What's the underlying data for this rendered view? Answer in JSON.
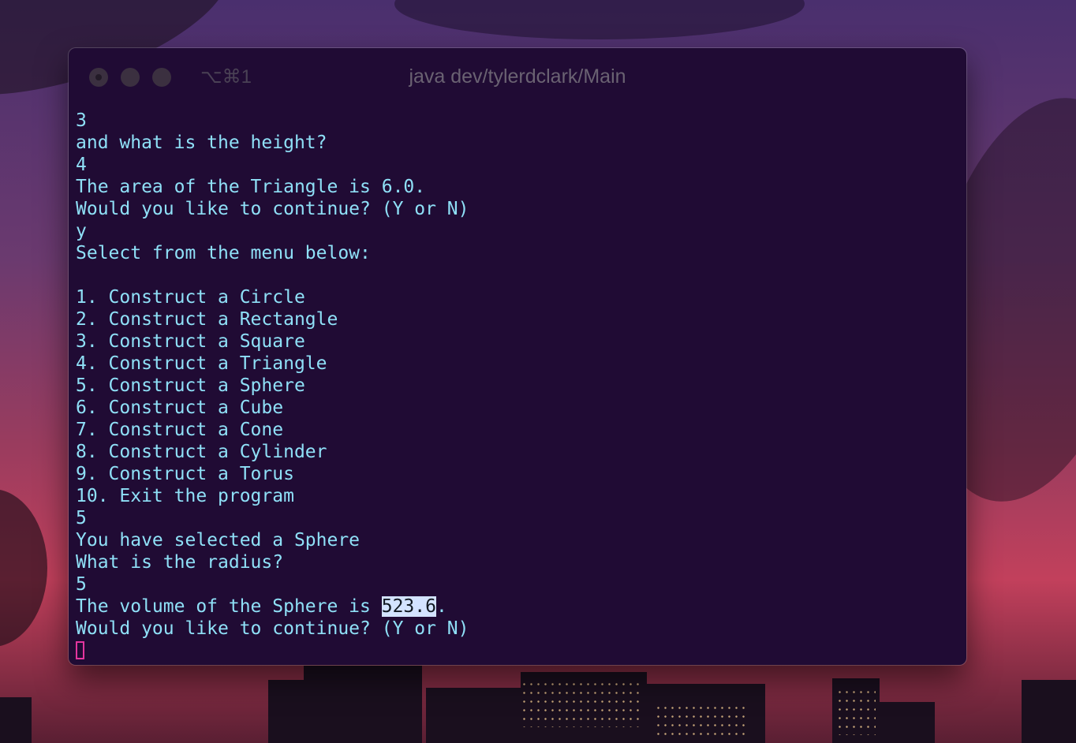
{
  "window": {
    "shortcut": "⌥⌘1",
    "title": "java dev/tylerdclark/Main"
  },
  "terminal": {
    "lines": [
      "3",
      "and what is the height?",
      "4",
      "The area of the Triangle is 6.0.",
      "Would you like to continue? (Y or N)",
      "y",
      "Select from the menu below:",
      "",
      "1. Construct a Circle",
      "2. Construct a Rectangle",
      "3. Construct a Square",
      "4. Construct a Triangle",
      "5. Construct a Sphere",
      "6. Construct a Cube",
      "7. Construct a Cone",
      "8. Construct a Cylinder",
      "9. Construct a Torus",
      "10. Exit the program",
      "5",
      "You have selected a Sphere",
      "What is the radius?",
      "5"
    ],
    "result_prefix": "The volume of the Sphere is ",
    "result_value": "523.6",
    "result_suffix": ".",
    "last_prompt": "Would you like to continue? (Y or N)"
  },
  "colors": {
    "terminal_background": "#200b34",
    "text": "#8fe0f7",
    "selection": "#d3e3ff",
    "cursor": "#e4359f"
  }
}
